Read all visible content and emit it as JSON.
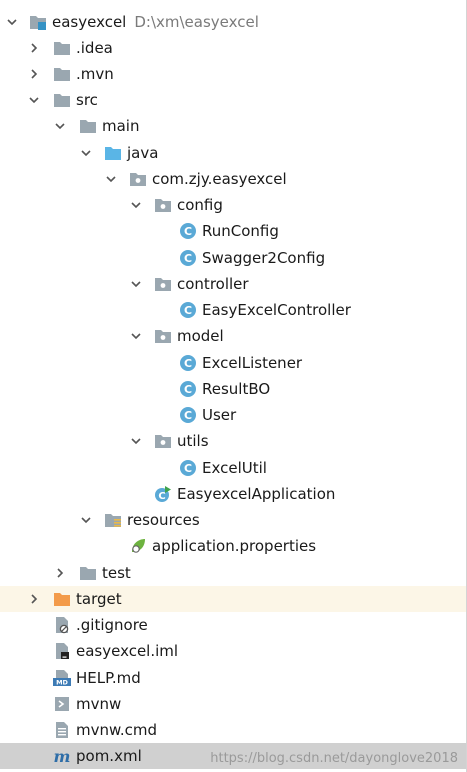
{
  "tree": {
    "root": {
      "label": "easyexcel",
      "path": "D:\\xm\\easyexcel"
    },
    "items": [
      {
        "label": ".idea",
        "icon": "folder-icon"
      },
      {
        "label": ".mvn",
        "icon": "folder-icon"
      },
      {
        "label": "src",
        "icon": "folder-icon"
      },
      {
        "label": "main",
        "icon": "folder-icon"
      },
      {
        "label": "java",
        "icon": "source-folder-icon"
      },
      {
        "label": "com.zjy.easyexcel",
        "icon": "package-icon"
      },
      {
        "label": "config",
        "icon": "package-icon"
      },
      {
        "label": "RunConfig",
        "icon": "class-icon"
      },
      {
        "label": "Swagger2Config",
        "icon": "class-icon"
      },
      {
        "label": "controller",
        "icon": "package-icon"
      },
      {
        "label": "EasyExcelController",
        "icon": "class-icon"
      },
      {
        "label": "model",
        "icon": "package-icon"
      },
      {
        "label": "ExcelListener",
        "icon": "class-icon"
      },
      {
        "label": "ResultBO",
        "icon": "class-icon"
      },
      {
        "label": "User",
        "icon": "class-icon"
      },
      {
        "label": "utils",
        "icon": "package-icon"
      },
      {
        "label": "ExcelUtil",
        "icon": "class-icon"
      },
      {
        "label": "EasyexcelApplication",
        "icon": "spring-boot-class-icon"
      },
      {
        "label": "resources",
        "icon": "resources-folder-icon"
      },
      {
        "label": "application.properties",
        "icon": "spring-properties-icon"
      },
      {
        "label": "test",
        "icon": "folder-icon"
      },
      {
        "label": "target",
        "icon": "excluded-folder-icon"
      },
      {
        "label": ".gitignore",
        "icon": "ignore-file-icon"
      },
      {
        "label": "easyexcel.iml",
        "icon": "iml-file-icon"
      },
      {
        "label": "HELP.md",
        "icon": "markdown-file-icon"
      },
      {
        "label": "mvnw",
        "icon": "shell-script-icon"
      },
      {
        "label": "mvnw.cmd",
        "icon": "text-file-icon"
      },
      {
        "label": "pom.xml",
        "icon": "maven-icon"
      }
    ]
  },
  "watermark": "https://blog.csdn.net/dayonglove2018",
  "colors": {
    "selected_bg": "#d0d0d0",
    "folder": "#9aa7b0",
    "source_folder": "#5ab5e6",
    "class": "#5aa9d6",
    "excluded": "#f39b4a",
    "path_gray": "#7a7a7a"
  }
}
